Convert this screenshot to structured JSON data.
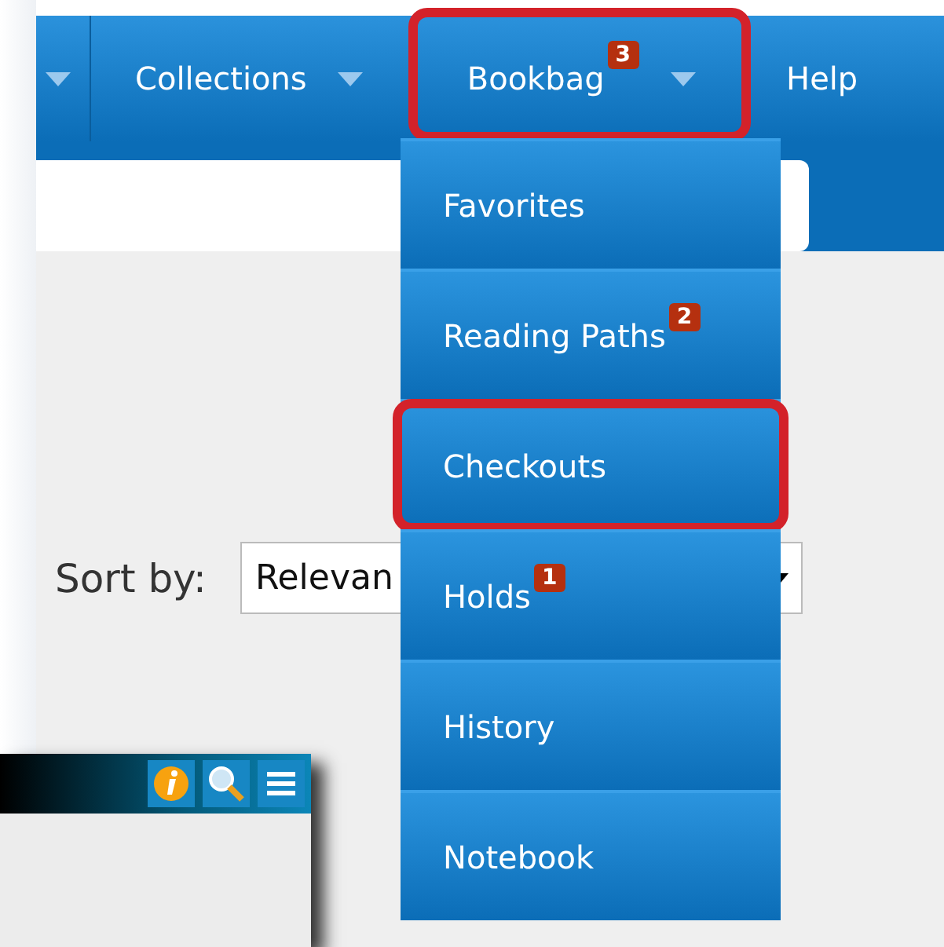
{
  "nav": {
    "items": [
      {
        "caret": true,
        "highlighted": false
      },
      {
        "label": "Collections",
        "caret": true,
        "highlighted": false
      },
      {
        "label": "Bookbag",
        "badge": "3",
        "caret": true,
        "highlighted": true
      },
      {
        "label": "Help",
        "caret": false,
        "highlighted": false
      }
    ]
  },
  "dropdown": {
    "items": [
      {
        "label": "Favorites",
        "highlighted": false
      },
      {
        "label": "Reading Paths",
        "badge": "2",
        "highlighted": false
      },
      {
        "label": "Checkouts",
        "highlighted": true
      },
      {
        "label": "Holds",
        "badge": "1",
        "highlighted": false
      },
      {
        "label": "History",
        "highlighted": false
      },
      {
        "label": "Notebook",
        "highlighted": false
      }
    ]
  },
  "sort": {
    "label": "Sort by:",
    "value": "Relevan"
  }
}
